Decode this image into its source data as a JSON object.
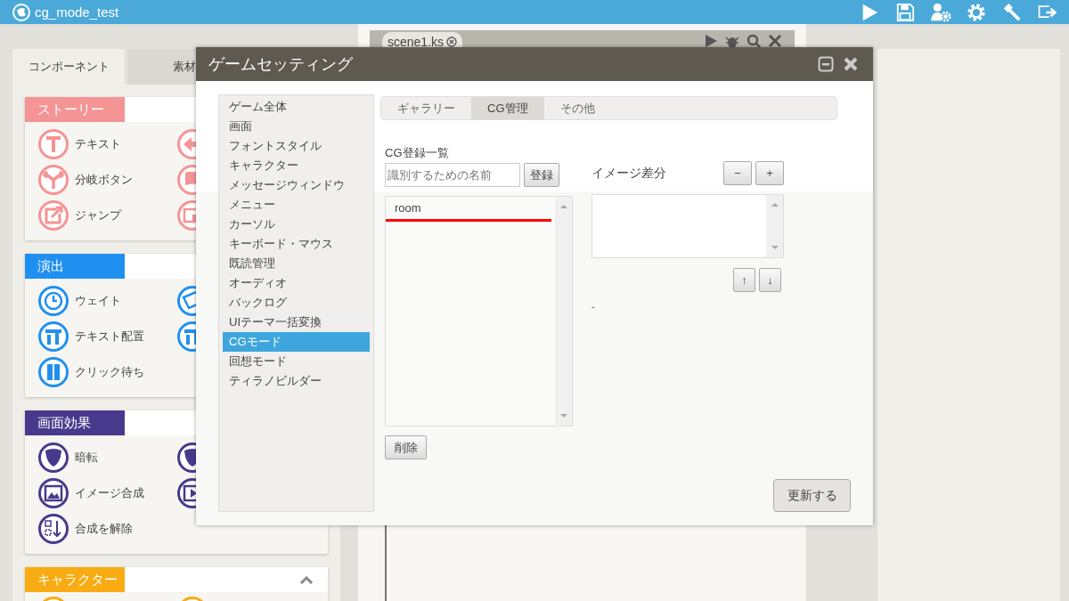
{
  "app_bar": {
    "title": "cg_mode_test"
  },
  "left_panel": {
    "tabs": [
      {
        "label": "コンポーネント",
        "selected": true
      },
      {
        "label": "素材",
        "selected": false
      }
    ],
    "sections": [
      {
        "title": "ストーリー",
        "color": "#f59494",
        "items": [
          {
            "label": "テキスト"
          },
          {
            "label": "分岐ボタン"
          },
          {
            "label": "ジャンプ"
          }
        ]
      },
      {
        "title": "演出",
        "color": "#2090f0",
        "items": [
          {
            "label": "ウェイト"
          },
          {
            "label": "テキスト配置"
          },
          {
            "label": "クリック待ち"
          }
        ]
      },
      {
        "title": "画面効果",
        "color": "#473a8c",
        "items": [
          {
            "label": "暗転"
          },
          {
            "label": "イメージ合成"
          },
          {
            "label": "合成を解除"
          }
        ]
      },
      {
        "title": "キャラクター",
        "color": "#f8ab12",
        "expanded": true
      }
    ]
  },
  "editor": {
    "tabs": [
      {
        "label": "scene1.ks"
      }
    ]
  },
  "dialog": {
    "title": "ゲームセッティング",
    "menu": [
      {
        "label": "ゲーム全体",
        "selected": false
      },
      {
        "label": "画面",
        "selected": false
      },
      {
        "label": "フォントスタイル",
        "selected": false
      },
      {
        "label": "キャラクター",
        "selected": false
      },
      {
        "label": "メッセージウィンドウ",
        "selected": false
      },
      {
        "label": "メニュー",
        "selected": false
      },
      {
        "label": "カーソル",
        "selected": false
      },
      {
        "label": "キーボード・マウス",
        "selected": false
      },
      {
        "label": "既読管理",
        "selected": false
      },
      {
        "label": "オーディオ",
        "selected": false
      },
      {
        "label": "バックログ",
        "selected": false
      },
      {
        "label": "UIテーマ一括変換",
        "selected": false
      },
      {
        "label": "CGモード",
        "selected": true
      },
      {
        "label": "回想モード",
        "selected": false
      },
      {
        "label": "ティラノビルダー",
        "selected": false
      }
    ],
    "tabs": [
      {
        "label": "ギャラリー",
        "selected": false
      },
      {
        "label": "CG管理",
        "selected": true
      },
      {
        "label": "その他",
        "selected": false
      }
    ],
    "cg_list": {
      "label": "CG登録一覧",
      "name_field": {
        "placeholder": "識別するための名前"
      },
      "register_button": "登録",
      "items": [
        {
          "label": "room",
          "underlined": true
        }
      ],
      "delete_button": "削除"
    },
    "variants": {
      "label": "イメージ差分",
      "remove_button": "−",
      "add_button": "+",
      "up_button": "↑",
      "down_button": "↓",
      "note": "-"
    },
    "update_button": "更新する"
  }
}
